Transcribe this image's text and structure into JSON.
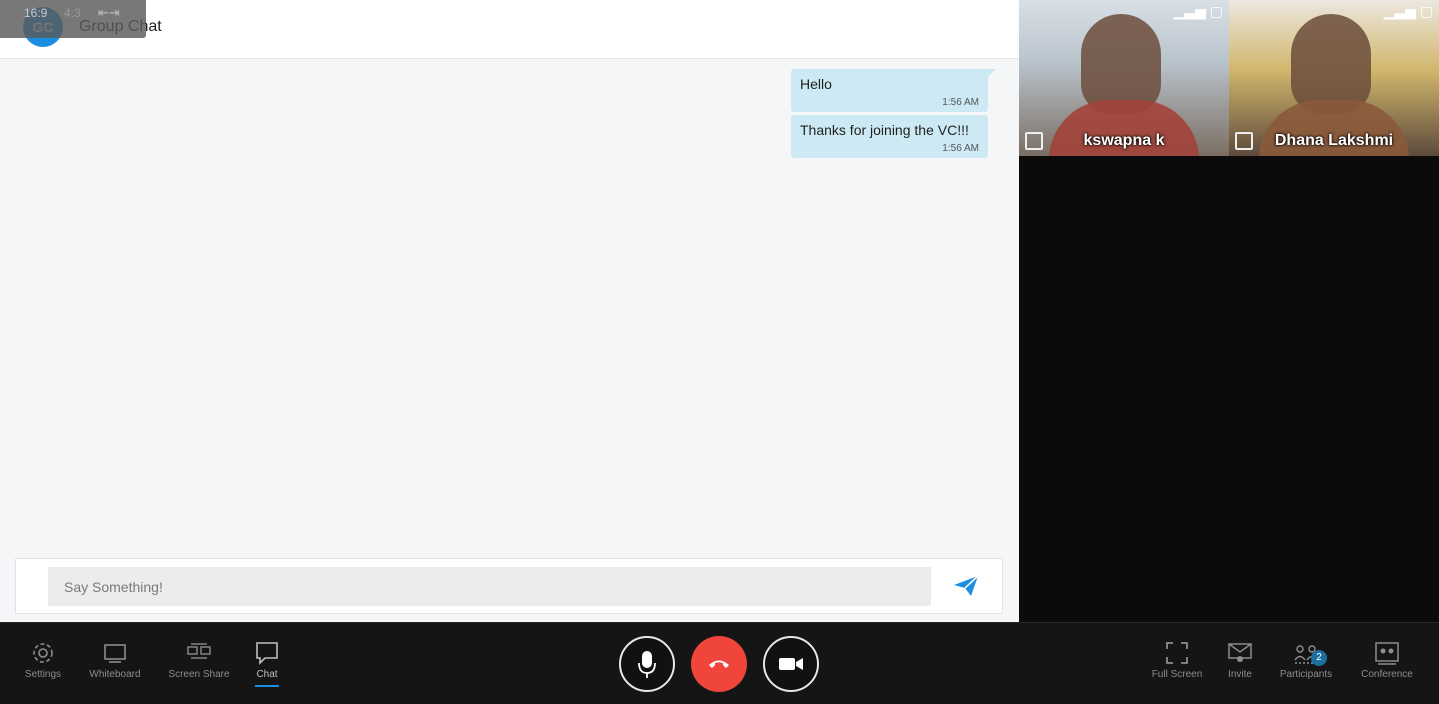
{
  "overlay": {
    "ratio_16_9": "16:9",
    "ratio_4_3": "4:3"
  },
  "chat": {
    "avatar_initials": "GC",
    "title": "Group Chat",
    "messages": [
      {
        "text": "Hello",
        "time": "1:56 AM"
      },
      {
        "text": "Thanks for joining the VC!!!",
        "time": "1:56 AM"
      }
    ],
    "input_placeholder": "Say Something!"
  },
  "participants": [
    {
      "name": "kswapna k"
    },
    {
      "name": "Dhana Lakshmi"
    }
  ],
  "toolbar": {
    "left": [
      {
        "label": "Settings",
        "icon": "gear-icon"
      },
      {
        "label": "Whiteboard",
        "icon": "whiteboard-icon"
      },
      {
        "label": "Screen Share",
        "icon": "screen-share-icon"
      },
      {
        "label": "Chat",
        "icon": "chat-icon",
        "active": true
      }
    ],
    "right": [
      {
        "label": "Full Screen",
        "icon": "fullscreen-icon"
      },
      {
        "label": "Invite",
        "icon": "invite-icon"
      },
      {
        "label": "Participants",
        "icon": "participants-icon",
        "badge": "2"
      },
      {
        "label": "Conference",
        "icon": "conference-icon"
      }
    ]
  },
  "colors": {
    "accent": "#1a8ee0",
    "end_call": "#f0453a",
    "bubble": "#cce9f4",
    "toolbar_bg": "#151515"
  }
}
